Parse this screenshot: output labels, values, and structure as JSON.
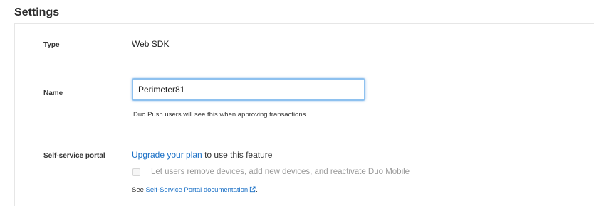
{
  "page": {
    "title": "Settings"
  },
  "settings": {
    "type": {
      "label": "Type",
      "value": "Web SDK"
    },
    "name": {
      "label": "Name",
      "value": "Perimeter81",
      "help_text": "Duo Push users will see this when approving transactions."
    },
    "self_service_portal": {
      "label": "Self-service portal",
      "upgrade_link": "Upgrade your plan",
      "upgrade_suffix": " to use this feature",
      "checkbox_label": "Let users remove devices, add new devices, and reactivate Duo Mobile",
      "checkbox_checked": false,
      "checkbox_disabled": true,
      "doc_prefix": "See ",
      "doc_link": "Self-Service Portal documentation",
      "doc_suffix": ".",
      "doc_icon": "external-link-icon"
    }
  },
  "colors": {
    "link": "#1a70c6",
    "focus_border": "#8ec1ef",
    "divider": "#e6e6e6",
    "disabled_text": "#999999"
  }
}
